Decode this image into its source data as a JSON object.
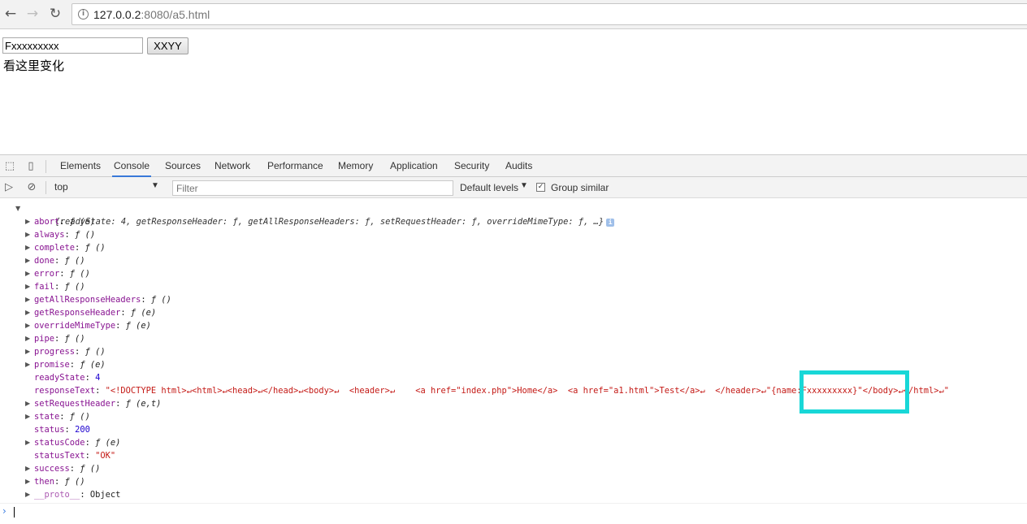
{
  "browser": {
    "back_icon": "arrow-left-icon",
    "forward_icon": "arrow-right-icon",
    "reload_icon": "reload-icon",
    "url_host": "127.0.0.2",
    "url_rest": ":8080/a5.html"
  },
  "page": {
    "input_value": "Fxxxxxxxxx",
    "button_label": "XXYY",
    "text": "看这里变化"
  },
  "devtools": {
    "tabs": [
      "Elements",
      "Console",
      "Sources",
      "Network",
      "Performance",
      "Memory",
      "Application",
      "Security",
      "Audits"
    ],
    "active_tab": "Console",
    "context": "top",
    "filter_placeholder": "Filter",
    "levels": "Default levels",
    "group_similar": "Group similar",
    "group_similar_checked": true
  },
  "console": {
    "summary": "{readyState: 4, getResponseHeader: ƒ, getAllResponseHeaders: ƒ, setRequestHeader: ƒ, overrideMimeType: ƒ, …}",
    "props": [
      {
        "key": "abort",
        "val": "ƒ (e)",
        "expandable": true,
        "kind": "fn"
      },
      {
        "key": "always",
        "val": "ƒ ()",
        "expandable": true,
        "kind": "fn"
      },
      {
        "key": "complete",
        "val": "ƒ ()",
        "expandable": true,
        "kind": "fn"
      },
      {
        "key": "done",
        "val": "ƒ ()",
        "expandable": true,
        "kind": "fn"
      },
      {
        "key": "error",
        "val": "ƒ ()",
        "expandable": true,
        "kind": "fn"
      },
      {
        "key": "fail",
        "val": "ƒ ()",
        "expandable": true,
        "kind": "fn"
      },
      {
        "key": "getAllResponseHeaders",
        "val": "ƒ ()",
        "expandable": true,
        "kind": "fn"
      },
      {
        "key": "getResponseHeader",
        "val": "ƒ (e)",
        "expandable": true,
        "kind": "fn"
      },
      {
        "key": "overrideMimeType",
        "val": "ƒ (e)",
        "expandable": true,
        "kind": "fn"
      },
      {
        "key": "pipe",
        "val": "ƒ ()",
        "expandable": true,
        "kind": "fn"
      },
      {
        "key": "progress",
        "val": "ƒ ()",
        "expandable": true,
        "kind": "fn"
      },
      {
        "key": "promise",
        "val": "ƒ (e)",
        "expandable": true,
        "kind": "fn"
      },
      {
        "key": "readyState",
        "val": "4",
        "expandable": false,
        "kind": "num"
      },
      {
        "key": "responseText",
        "val": "\"<!DOCTYPE html>↵<html>↵<head>↵</head>↵<body>↵  <header>↵    <a href=\"index.php\">Home</a>  <a href=\"a1.html\">Test</a>↵  </header>↵\"{name:Fxxxxxxxxx}\"</body>↵</html>↵\"",
        "expandable": false,
        "kind": "str"
      },
      {
        "key": "setRequestHeader",
        "val": "ƒ (e,t)",
        "expandable": true,
        "kind": "fn"
      },
      {
        "key": "state",
        "val": "ƒ ()",
        "expandable": true,
        "kind": "fn"
      },
      {
        "key": "status",
        "val": "200",
        "expandable": false,
        "kind": "num"
      },
      {
        "key": "statusCode",
        "val": "ƒ (e)",
        "expandable": true,
        "kind": "fn"
      },
      {
        "key": "statusText",
        "val": "\"OK\"",
        "expandable": false,
        "kind": "str"
      },
      {
        "key": "success",
        "val": "ƒ ()",
        "expandable": true,
        "kind": "fn"
      },
      {
        "key": "then",
        "val": "ƒ ()",
        "expandable": true,
        "kind": "fn"
      },
      {
        "key": "__proto__",
        "val": "Object",
        "expandable": true,
        "kind": "obj"
      }
    ],
    "prompt": "›"
  },
  "colors": {
    "accent_tab": "#3879d9",
    "highlight": "#18d7d7",
    "key": "#881391",
    "string": "#c41a16",
    "number": "#1c00cf"
  }
}
